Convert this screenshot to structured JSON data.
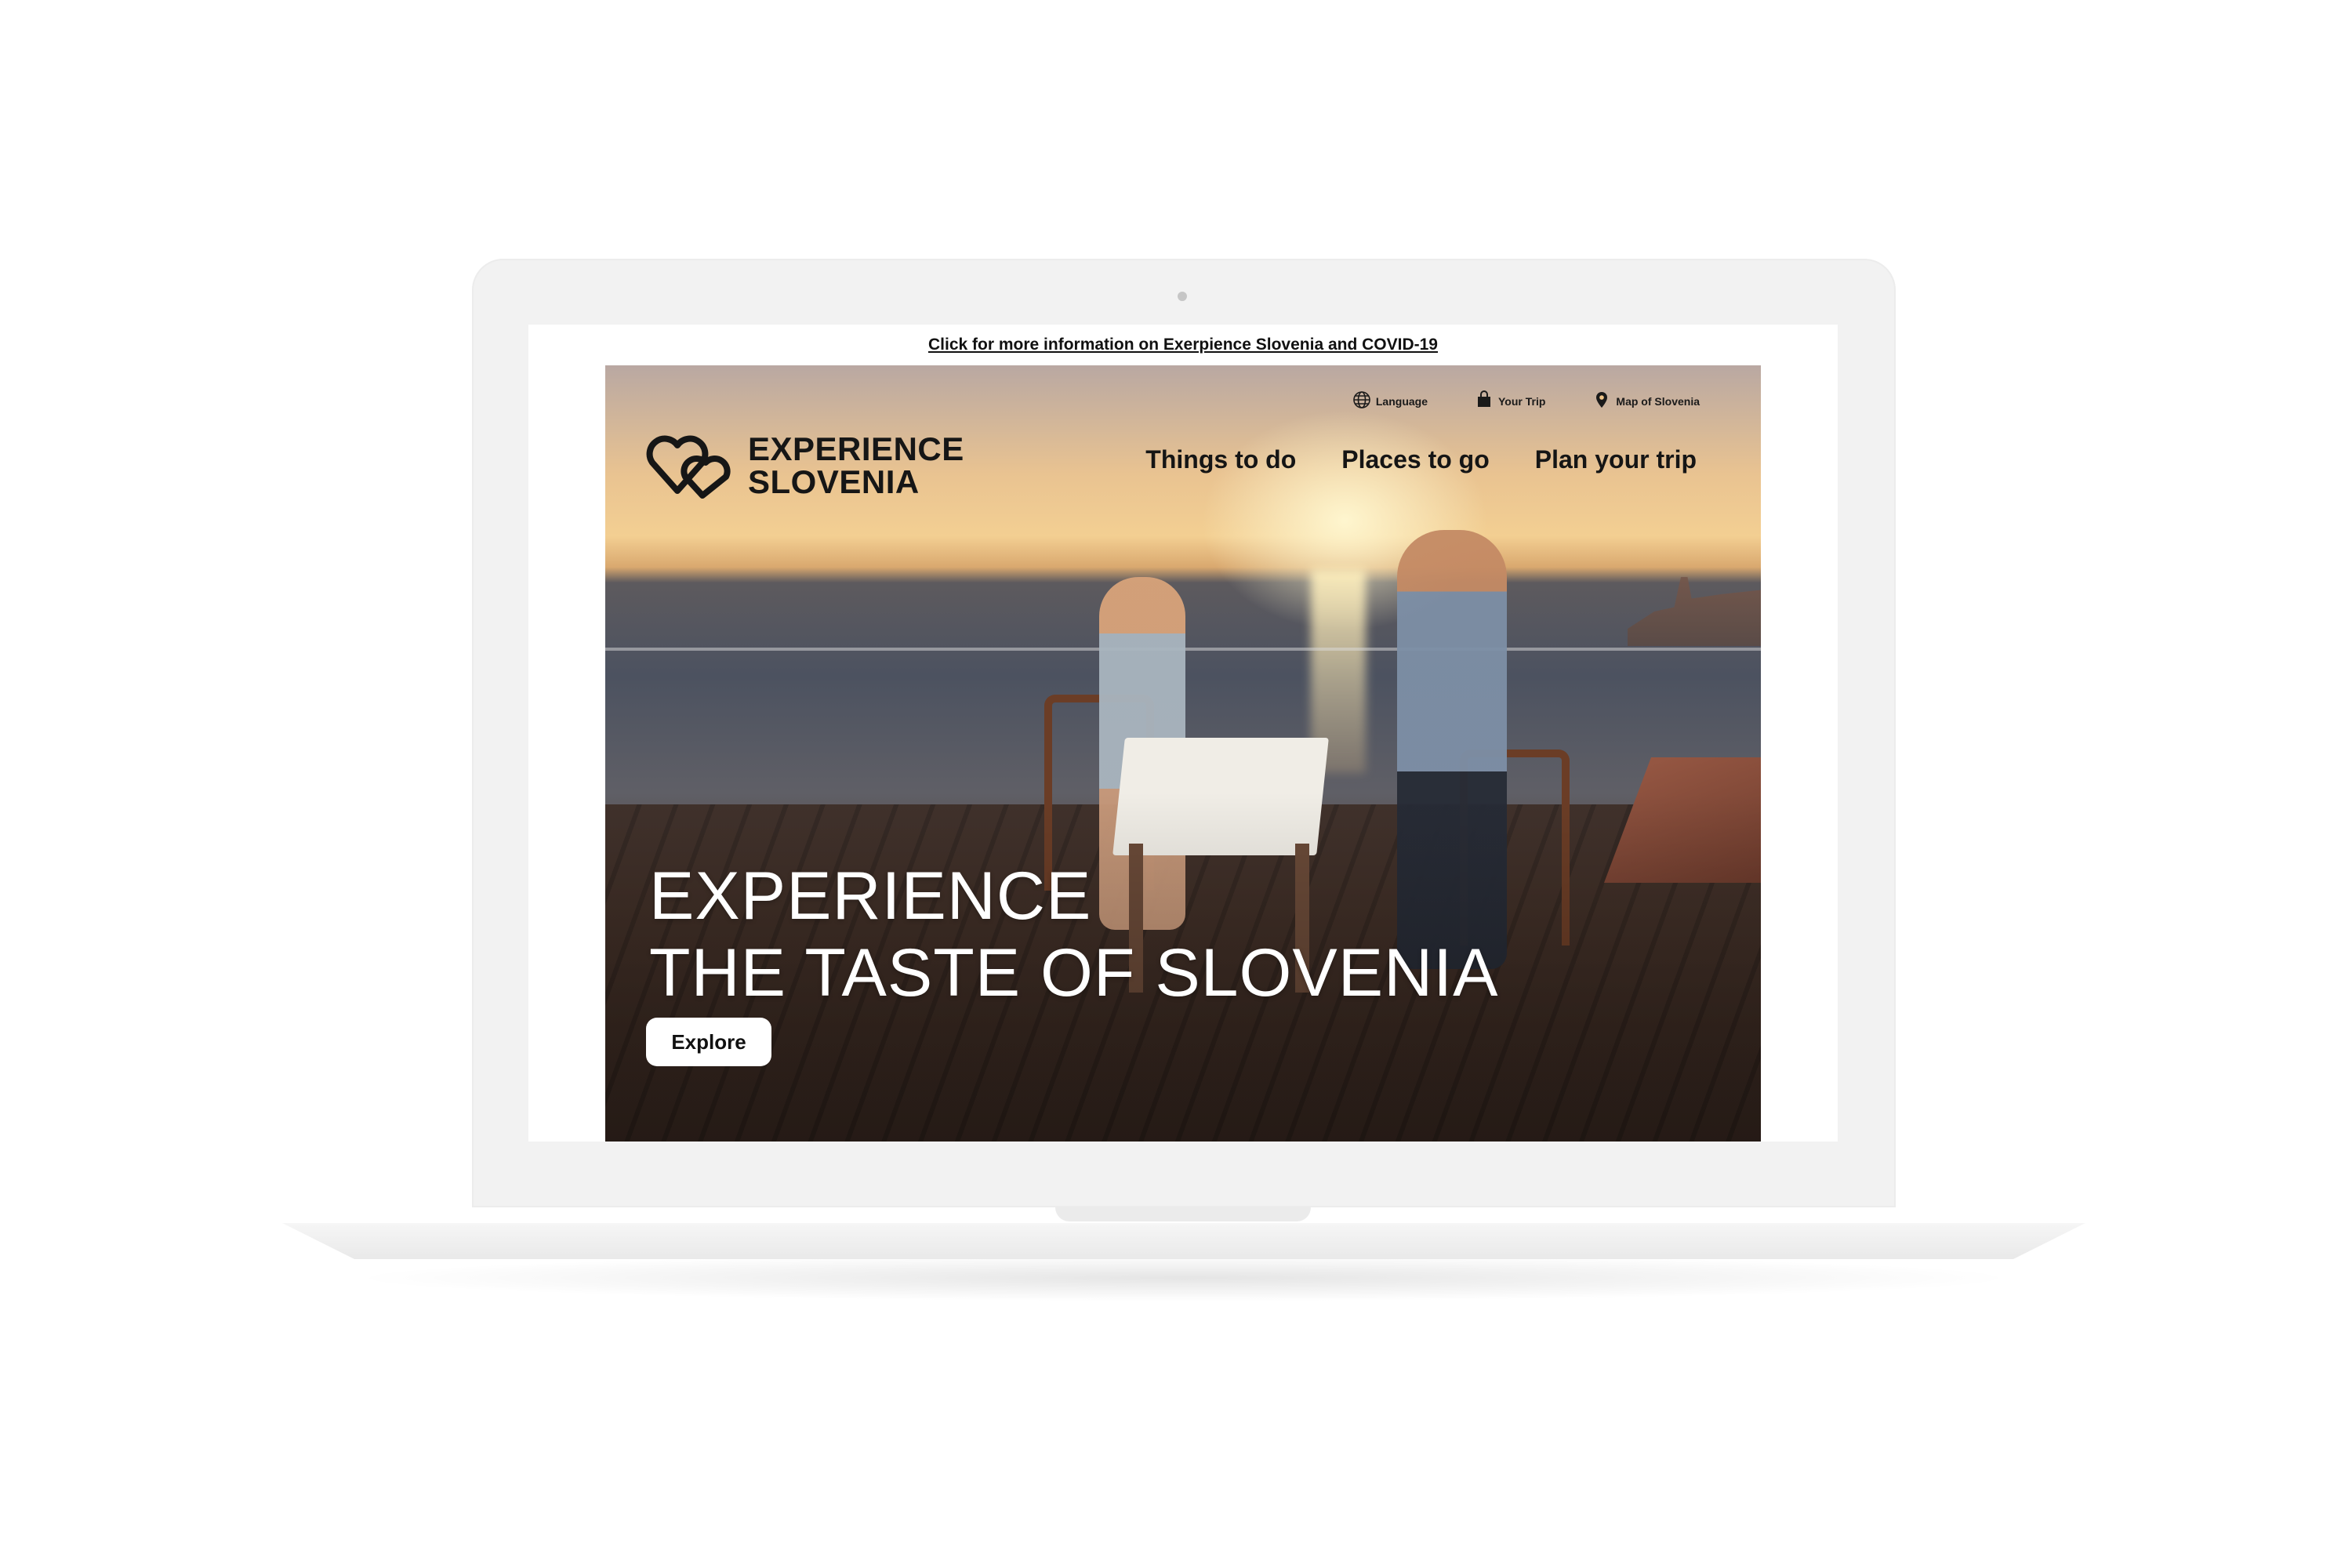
{
  "announcement": {
    "text": "Click for more information on Exerpience Slovenia and COVID-19"
  },
  "utility_nav": [
    {
      "label": "Language",
      "icon": "globe-icon"
    },
    {
      "label": "Your Trip",
      "icon": "bag-icon"
    },
    {
      "label": "Map of Slovenia",
      "icon": "map-pin-icon"
    }
  ],
  "logo": {
    "line1": "EXPERIENCE",
    "line2": "SLOVENIA",
    "icon": "double-heart-icon"
  },
  "main_nav": [
    {
      "label": "Things to do"
    },
    {
      "label": "Places to go"
    },
    {
      "label": "Plan your trip"
    }
  ],
  "hero": {
    "headline_line1": "EXPERIENCE",
    "headline_line2": "THE TASTE OF SLOVENIA",
    "cta_label": "Explore"
  },
  "colors": {
    "text_dark": "#151515",
    "hero_text": "#ffffff",
    "button_bg": "#ffffff"
  }
}
